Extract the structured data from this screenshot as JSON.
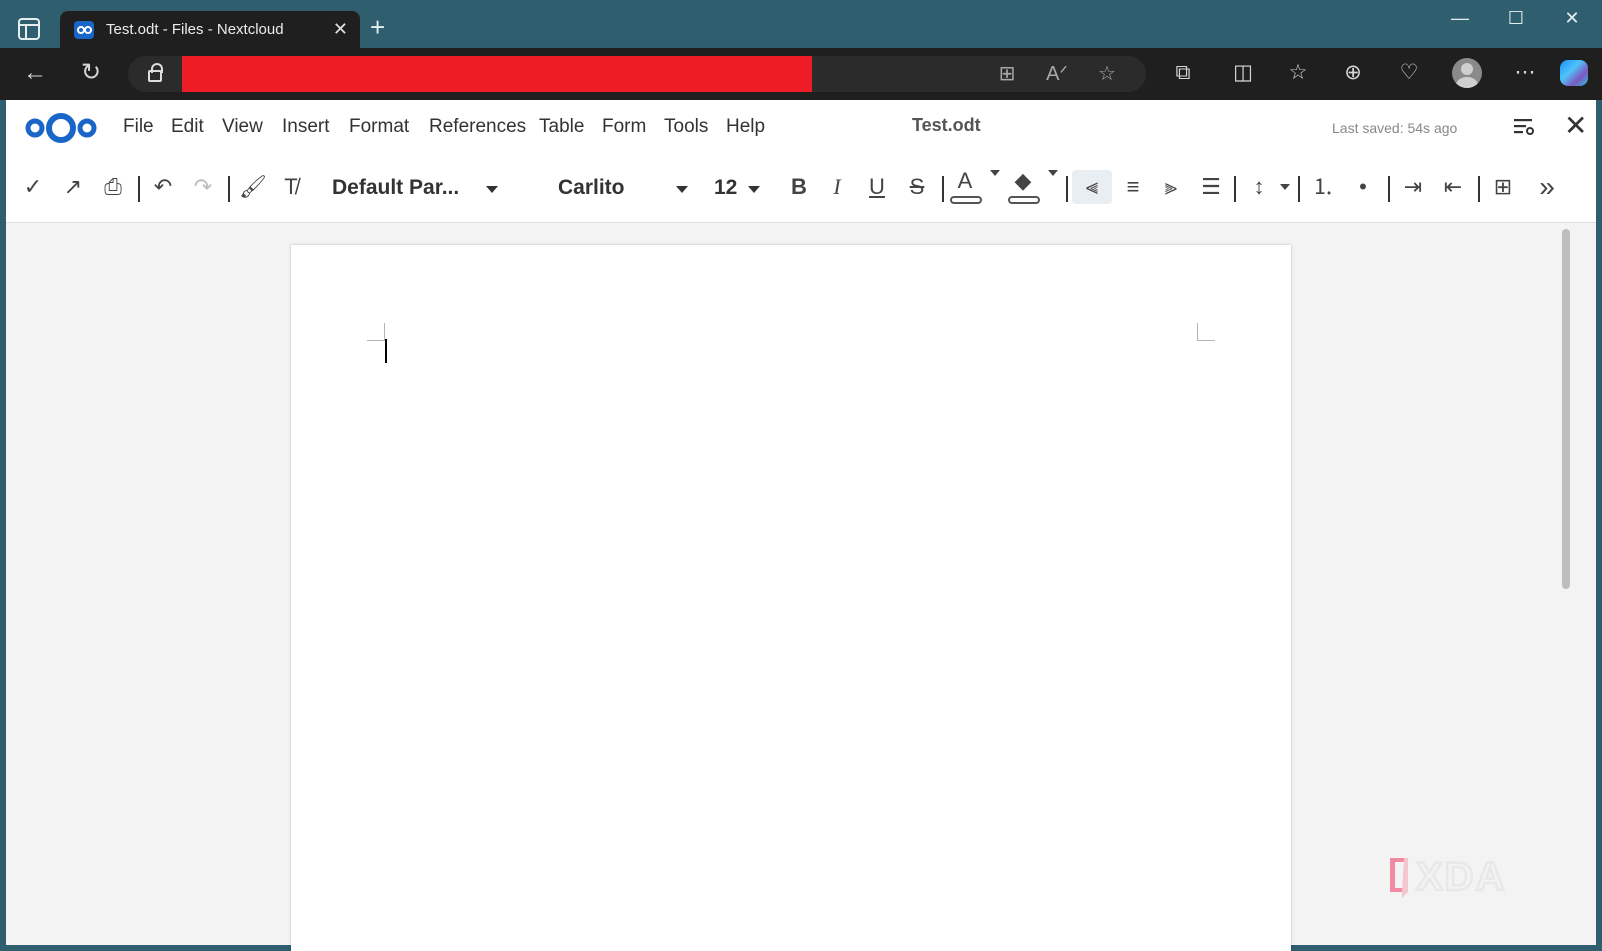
{
  "browser": {
    "tab_title": "Test.odt - Files - Nextcloud",
    "tab_close": "✕",
    "new_tab": "+",
    "window": {
      "minimize": "—",
      "maximize": "☐",
      "close": "✕"
    },
    "nav": {
      "back": "←",
      "reload": "↻"
    },
    "url_actions": {
      "apps": "⊞",
      "read_aloud": "Aᐟ",
      "favorite": "☆"
    },
    "tools": {
      "extensions": "⧉",
      "split": "◫",
      "favorites": "☆",
      "collections": "⊕",
      "health": "♡",
      "more": "⋯"
    },
    "colors": {
      "chrome": "#2f5f6e",
      "toolbar": "#1f1f1f",
      "redaction": "#ee1c24"
    }
  },
  "app": {
    "menu": [
      "File",
      "Edit",
      "View",
      "Insert",
      "Format",
      "References",
      "Table",
      "Form",
      "Tools",
      "Help"
    ],
    "doc_title": "Test.odt",
    "last_saved": "Last saved: 54s ago",
    "close": "✕",
    "brand_color": "#1a66c8"
  },
  "toolbar": {
    "paragraph_style": "Default Par...",
    "font_name": "Carlito",
    "font_size": "12",
    "icons": {
      "save": "✓",
      "export": "↗",
      "print": "⎙",
      "undo": "↶",
      "redo": "↷",
      "clone_format": "🖌",
      "clear_format": "T̸",
      "bold": "B",
      "italic": "I",
      "underline": "U",
      "strikethrough": "S",
      "font_color": "A",
      "highlight": "◆",
      "align_left": "⫷",
      "align_center": "≡",
      "align_right": "⫸",
      "justify": "☰",
      "line_spacing": "↕",
      "numbered_list": "⒈",
      "bullet_list": "•",
      "indent_increase": "⇥",
      "indent_decrease": "⇤",
      "insert_table": "⊞",
      "more": "»"
    }
  }
}
